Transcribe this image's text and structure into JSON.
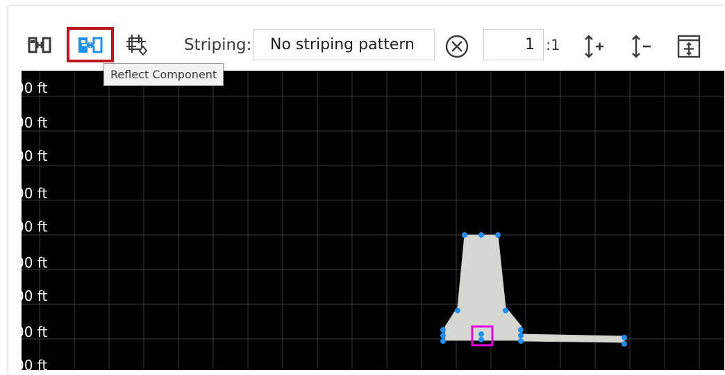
{
  "toolbar": {
    "striping_label": "Striping:",
    "striping_value": "No striping pattern",
    "ratio_value": "1",
    "ratio_suffix": ":1",
    "buttons": [
      {
        "name": "flip-component",
        "icon": "flip-component-icon"
      },
      {
        "name": "reflect-component",
        "icon": "reflect-component-icon",
        "selected": true
      },
      {
        "name": "move-vertex",
        "icon": "move-vertex-icon"
      },
      {
        "name": "clear-striping",
        "icon": "clear-circle-icon"
      },
      {
        "name": "increase-vertical-scale",
        "icon": "vertical-scale-increase-icon"
      },
      {
        "name": "decrease-vertical-scale",
        "icon": "vertical-scale-decrease-icon"
      },
      {
        "name": "zoom-extents",
        "icon": "zoom-extents-icon"
      }
    ]
  },
  "tooltip": {
    "text": "Reflect Component"
  },
  "canvas": {
    "axis_labels": [
      "00 ft",
      "00 ft",
      "00 ft",
      "00 ft",
      "00 ft",
      "00 ft",
      "00 ft",
      "00 ft",
      "00 ft"
    ],
    "colors": {
      "background": "#000000",
      "grid": "#3a3a3a",
      "shape_fill": "#d7d7d2",
      "vertex": "#1f8ff0",
      "selection": "#e000e0",
      "highlight": "#c0141c"
    }
  }
}
